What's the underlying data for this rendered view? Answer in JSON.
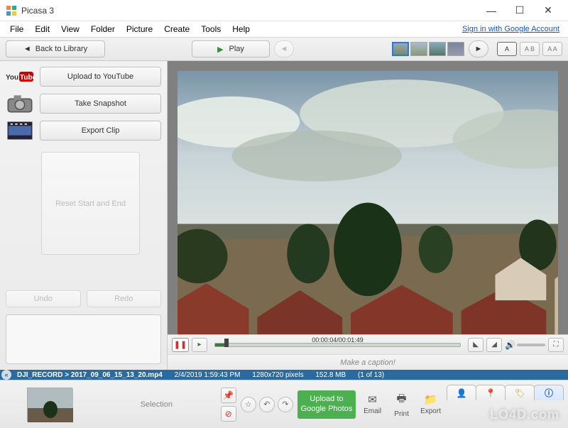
{
  "window": {
    "title": "Picasa 3",
    "min": "—",
    "max": "☐",
    "close": "✕"
  },
  "menu": {
    "items": [
      "File",
      "Edit",
      "View",
      "Folder",
      "Picture",
      "Create",
      "Tools",
      "Help"
    ],
    "signin": "Sign in with Google Account"
  },
  "toolbar": {
    "back_label": "Back to Library",
    "play_label": "Play",
    "size_labels": [
      "A",
      "A B",
      "A A"
    ]
  },
  "sidebar": {
    "youtube_label": "Upload to YouTube",
    "snapshot_label": "Take Snapshot",
    "export_label": "Export Clip",
    "reset_label": "Reset Start and End",
    "undo_label": "Undo",
    "redo_label": "Redo"
  },
  "player": {
    "time": "00:00:04/00:01:49"
  },
  "caption": {
    "placeholder": "Make a caption!"
  },
  "info": {
    "path": "DJI_RECORD > 2017_09_06_15_13_20.mp4",
    "date": "2/4/2019 1:59:43 PM",
    "dims": "1280x720 pixels",
    "size": "152.8 MB",
    "count": "(1 of 13)"
  },
  "tray": {
    "selection_label": "Selection",
    "upload_label": "Upload to Google Photos",
    "email_label": "Email",
    "print_label": "Print",
    "export_label": "Export"
  },
  "watermark": "LO4D.com"
}
